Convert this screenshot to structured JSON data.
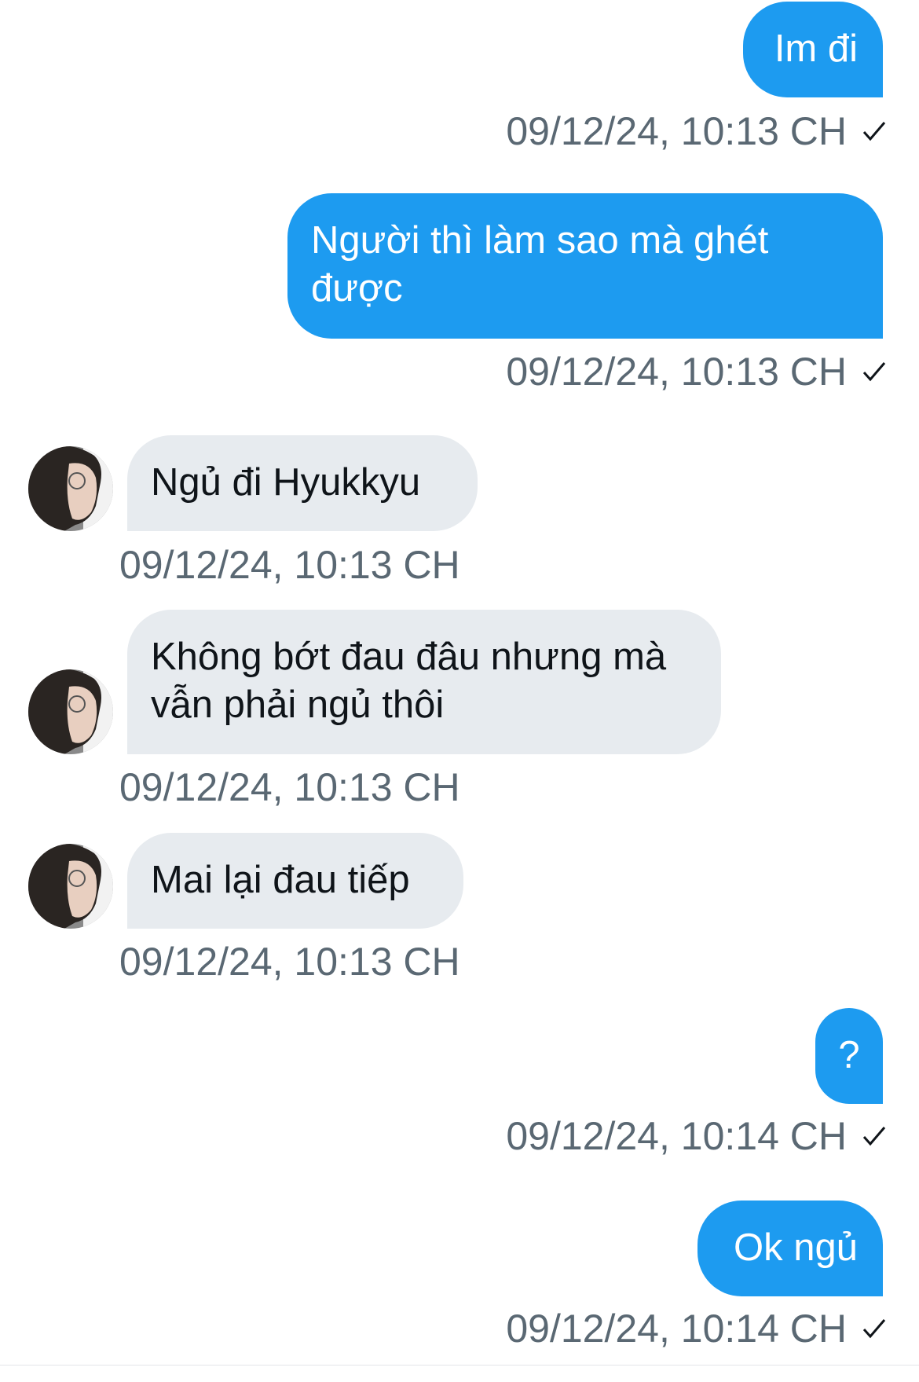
{
  "messages": [
    {
      "direction": "sent",
      "text": "Im đi",
      "time": "09/12/24, 10:13 CH",
      "read_icon": "check-icon"
    },
    {
      "direction": "sent",
      "text": "Người thì làm sao mà ghét được",
      "time": "09/12/24, 10:13 CH",
      "read_icon": "check-icon"
    },
    {
      "direction": "received",
      "text": "Ngủ đi Hyukkyu",
      "time": "09/12/24, 10:13 CH",
      "avatar_icon": "avatar-icon"
    },
    {
      "direction": "received",
      "text": "Không bớt đau đâu nhưng mà vẫn phải ngủ thôi",
      "time": "09/12/24, 10:13 CH",
      "avatar_icon": "avatar-icon"
    },
    {
      "direction": "received",
      "text": "Mai lại đau tiếp",
      "time": "09/12/24, 10:13 CH",
      "avatar_icon": "avatar-icon"
    },
    {
      "direction": "sent",
      "text": "?",
      "time": "09/12/24, 10:14 CH",
      "read_icon": "check-icon"
    },
    {
      "direction": "sent",
      "text": "Ok ngủ",
      "time": "09/12/24, 10:14 CH",
      "read_icon": "check-icon"
    }
  ],
  "colors": {
    "sent_bubble": "#1d9bf0",
    "received_bubble": "#e7ebef",
    "timestamp": "#5a6873"
  }
}
